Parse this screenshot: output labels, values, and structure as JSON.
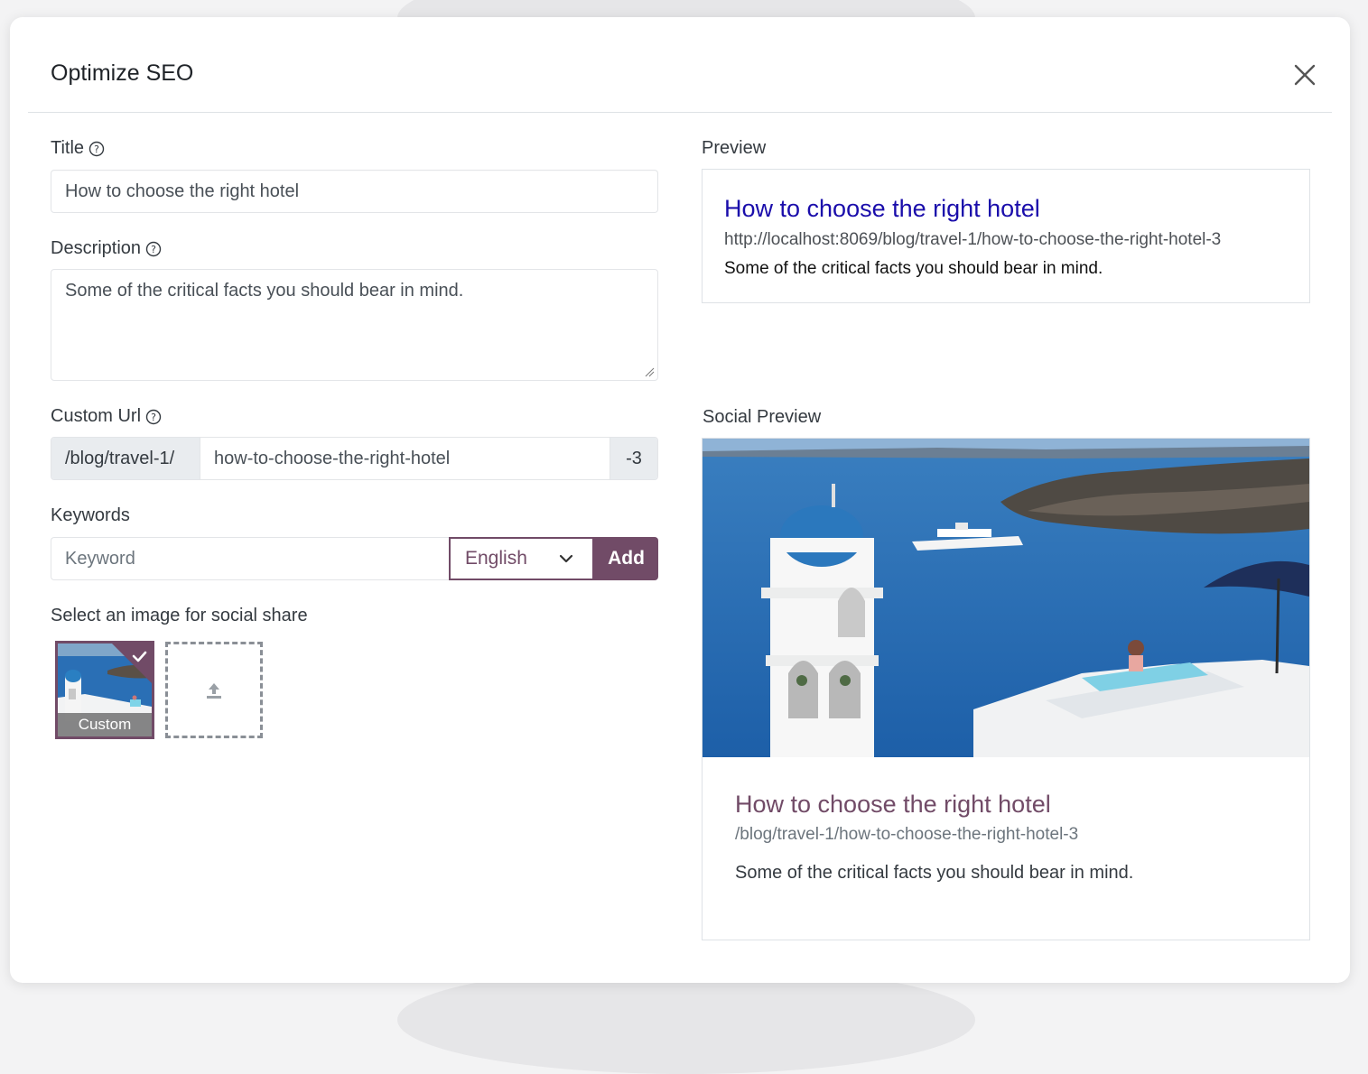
{
  "dialog": {
    "title": "Optimize SEO"
  },
  "form": {
    "title_label": "Title",
    "title_value": "How to choose the right hotel",
    "description_label": "Description",
    "description_value": "Some of the critical facts you should bear in mind.",
    "custom_url_label": "Custom Url",
    "url_prefix": "/blog/travel-1/",
    "url_slug": "how-to-choose-the-right-hotel",
    "url_suffix": "-3",
    "keywords_label": "Keywords",
    "keyword_placeholder": "Keyword",
    "language_selected": "English",
    "add_label": "Add",
    "image_label": "Select an image for social share",
    "image_option_caption": "Custom"
  },
  "preview": {
    "label": "Preview",
    "title": "How to choose the right hotel",
    "url": "http://localhost:8069/blog/travel-1/how-to-choose-the-right-hotel-3",
    "description": "Some of the critical facts you should bear in mind."
  },
  "social_preview": {
    "label": "Social Preview",
    "title": "How to choose the right hotel",
    "url": "/blog/travel-1/how-to-choose-the-right-hotel-3",
    "description": "Some of the critical facts you should bear in mind."
  },
  "icons": {
    "close": "close-icon",
    "help": "question-circle-icon",
    "dropdown": "chevron-down-icon",
    "upload": "upload-icon",
    "selected": "checkmark-icon"
  },
  "colors": {
    "accent": "#714b67",
    "google_link": "#1a0dab"
  }
}
